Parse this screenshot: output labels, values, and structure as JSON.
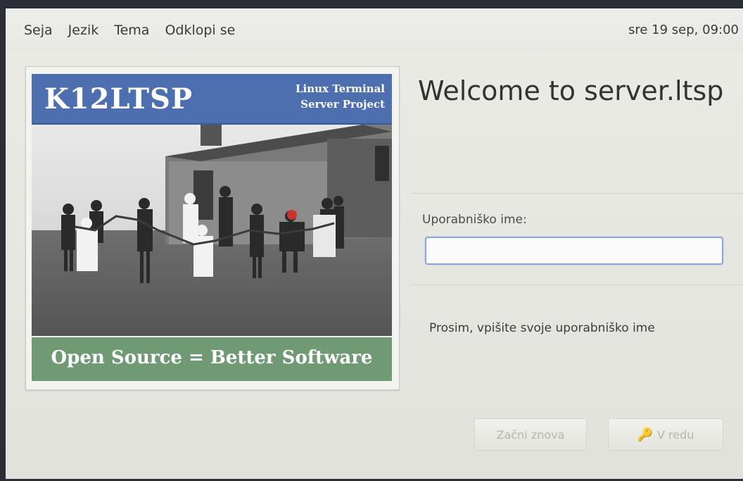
{
  "menubar": {
    "items": [
      {
        "label": "Seja"
      },
      {
        "label": "Jezik"
      },
      {
        "label": "Tema"
      },
      {
        "label": "Odklopi se"
      }
    ],
    "clock": "sre 19 sep, 09:00"
  },
  "logo": {
    "title": "K12LTSP",
    "subtitle_line1": "Linux Terminal",
    "subtitle_line2": "Server Project",
    "tagline": "Open Source = Better Software"
  },
  "login": {
    "welcome": "Welcome to server.ltsp",
    "username_label": "Uporabniško ime:",
    "username_value": "",
    "prompt": "Prosim, vpišite svoje uporabniško ime"
  },
  "buttons": {
    "restart": "Začni znova",
    "ok": "V redu",
    "ok_icon": "key-icon"
  },
  "colors": {
    "logo_header": "#4d6fb0",
    "logo_footer": "#6f9a74",
    "input_focus": "#8aa7d6"
  }
}
